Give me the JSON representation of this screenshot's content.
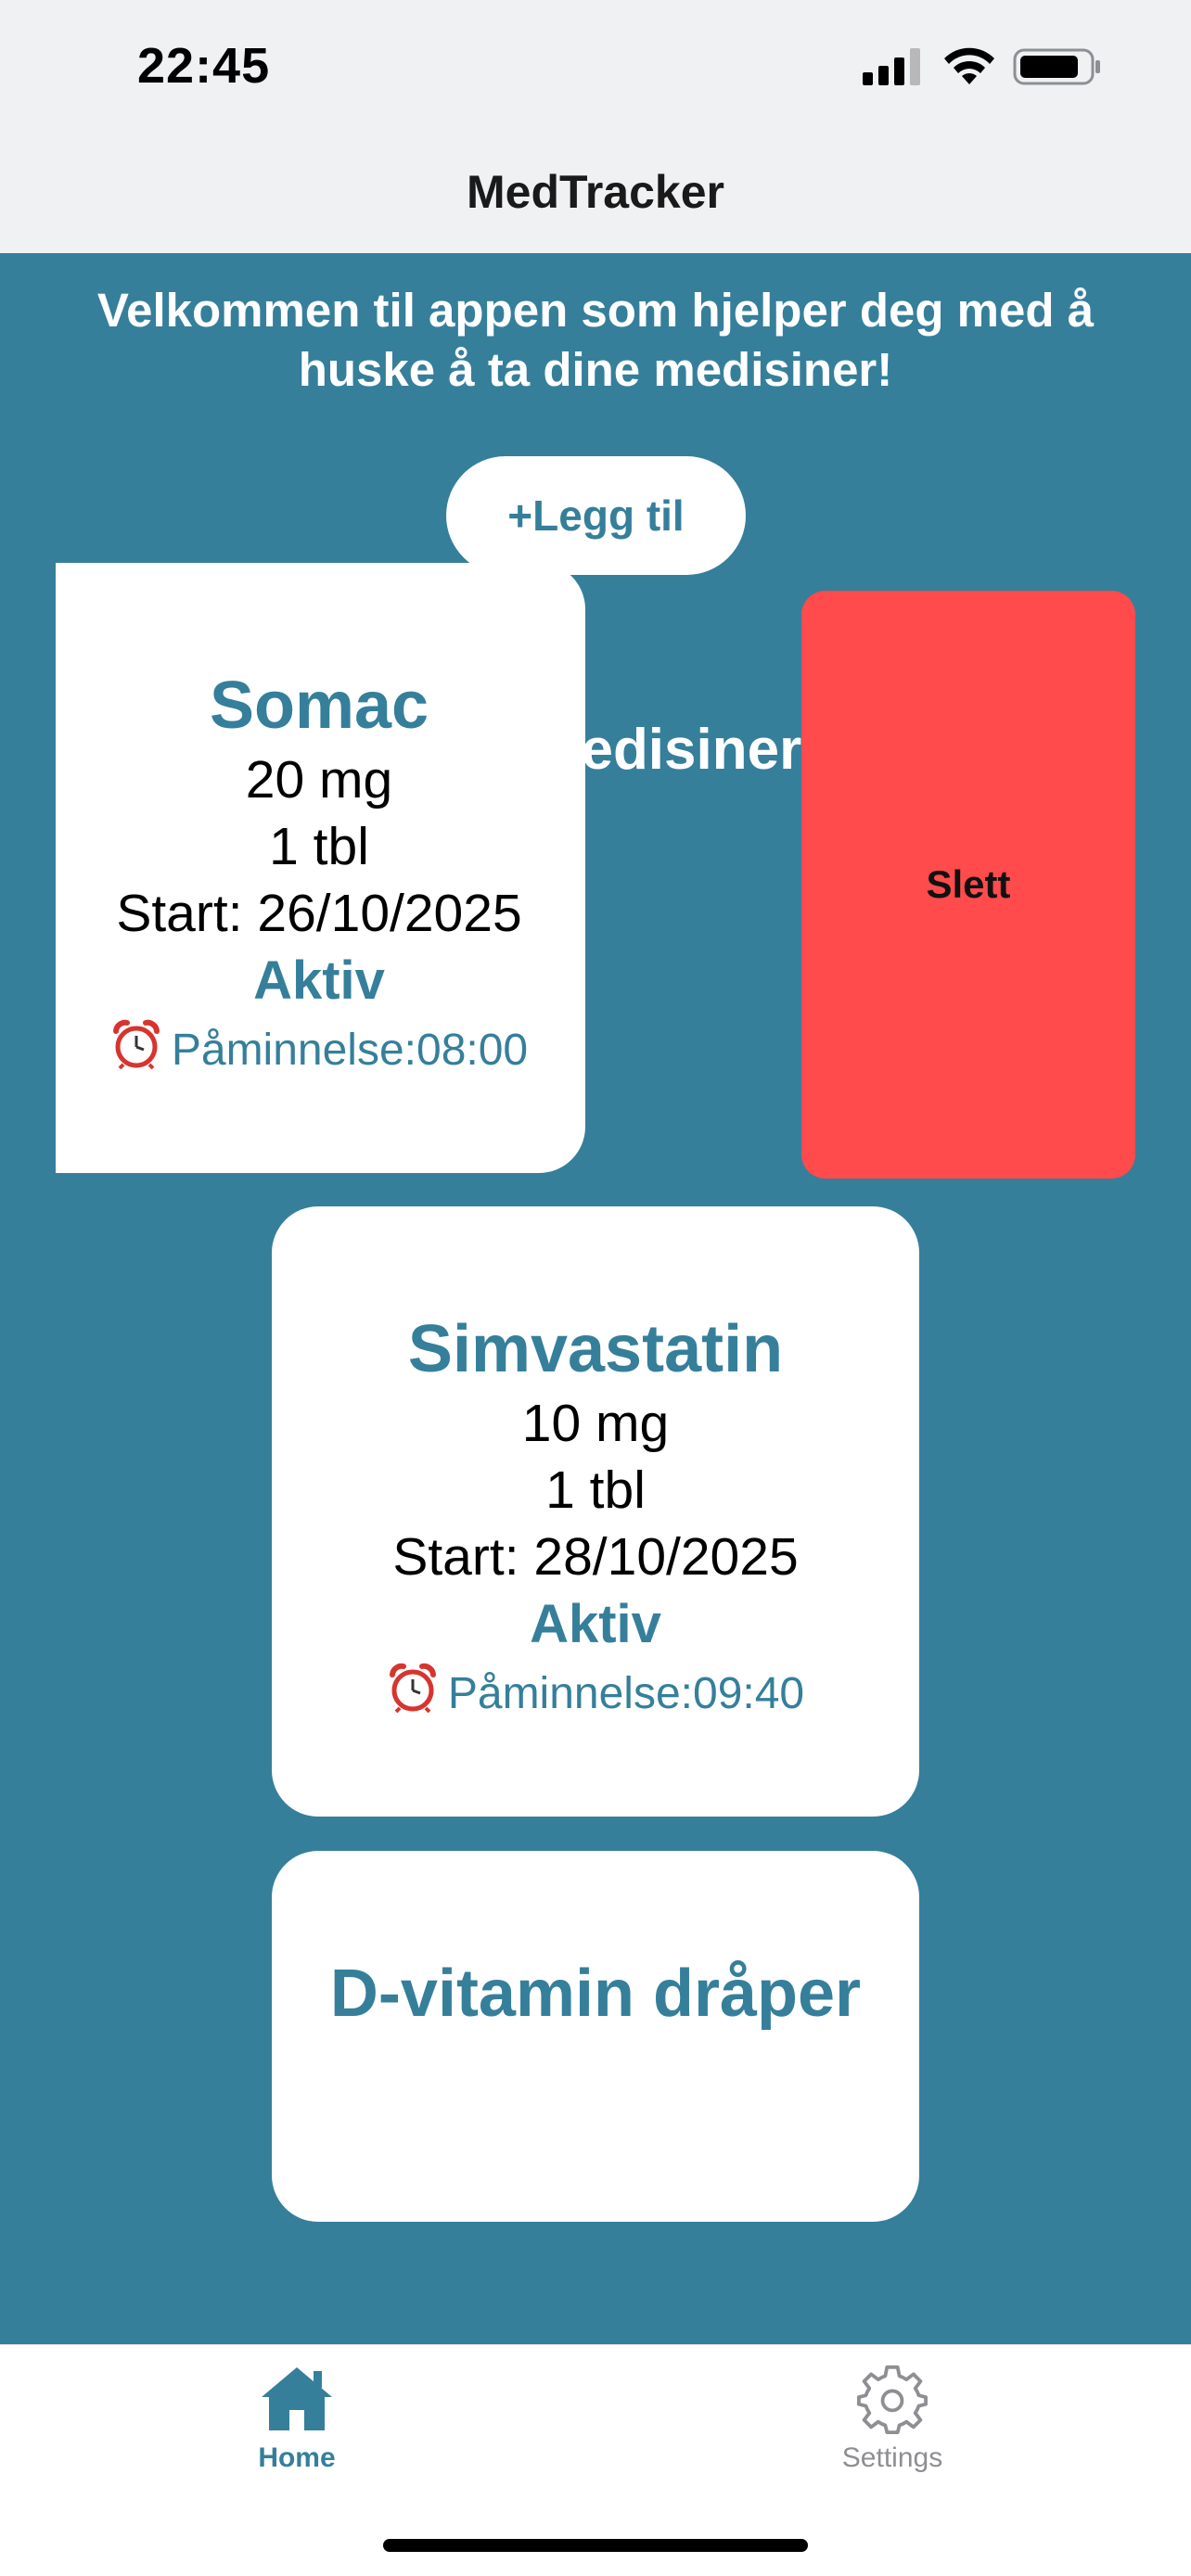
{
  "status_bar": {
    "time": "22:45"
  },
  "nav": {
    "title": "MedTracker"
  },
  "welcome_text": "Velkommen til appen som hjelper deg med å huske å ta dine medisiner!",
  "add_button_label": "+Legg til",
  "section_title": "Dine medisiner",
  "delete_label": "Slett",
  "medications": [
    {
      "name": "Somac",
      "dose": "20 mg",
      "amount": "1 tbl",
      "start": "Start: 26/10/2025",
      "status": "Aktiv",
      "reminder": "Påminnelse:08:00"
    },
    {
      "name": "Simvastatin",
      "dose": "10 mg",
      "amount": "1 tbl",
      "start": "Start: 28/10/2025",
      "status": "Aktiv",
      "reminder": "Påminnelse:09:40"
    },
    {
      "name": "D-vitamin dråper"
    }
  ],
  "tabs": [
    {
      "label": "Home",
      "icon": "home-icon",
      "active": true
    },
    {
      "label": "Settings",
      "icon": "gear-icon",
      "active": false
    }
  ],
  "colors": {
    "primary": "#357f9b",
    "delete": "#ff4b4b",
    "header_bg": "#f0f1f3"
  }
}
